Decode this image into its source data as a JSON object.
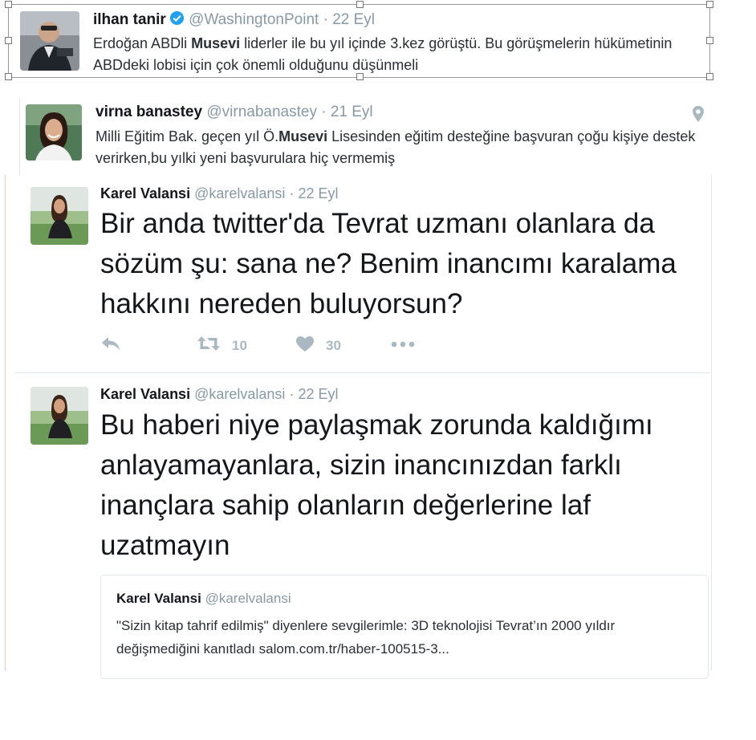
{
  "tweets": [
    {
      "name": "ilhan tanir",
      "handle": "@WashingtonPoint",
      "time": "22 Eyl",
      "verified": true,
      "text_before": "Erdoğan ABDli ",
      "text_bold": "Musevi",
      "text_after": " liderler ile bu yıl içinde 3.kez görüştü. Bu görüşmelerin hükümetinin ABDdeki lobisi için çok önemli olduğunu düşünmeli"
    },
    {
      "name": "virna banastey",
      "handle": "@virnabanastey",
      "time": "21 Eyl",
      "text_before": "Milli Eğitim Bak. geçen yıl Ö.",
      "text_bold": "Musevi",
      "text_after": " Lisesinden eğitim desteğine başvuran çoğu kişiye destek verirken,bu yılki yeni başvurulara hiç vermemiş",
      "icon": "location-pin-icon"
    },
    {
      "name": "Karel Valansi",
      "handle": "@karelvalansi",
      "time": "22 Eyl",
      "text": "Bir anda twitter'da Tevrat uzmanı olanlara da sözüm şu: sana ne? Benim inancımı karalama hakkını nereden buluyorsun?",
      "retweets": "10",
      "likes": "30"
    },
    {
      "name": "Karel Valansi",
      "handle": "@karelvalansi",
      "time": "22 Eyl",
      "text": "Bu haberi niye paylaşmak zorunda kaldığımı anlayamayanlara, sizin inancınızdan farklı inançlara sahip olanların değerlerine laf uzatmayın",
      "quote": {
        "name": "Karel Valansi",
        "handle": "@karelvalansi",
        "text": "\"Sizin kitap tahrif edilmiş\" diyenlere sevgilerimle: 3D teknolojisi Tevrat’ın 2000 yıldır değişmediğini kanıtladı salom.com.tr/haber-100515-3..."
      }
    }
  ],
  "separator": "·",
  "colors": {
    "verified": "#1da1f2",
    "muted": "#8899a6",
    "action": "#aab8c2"
  }
}
